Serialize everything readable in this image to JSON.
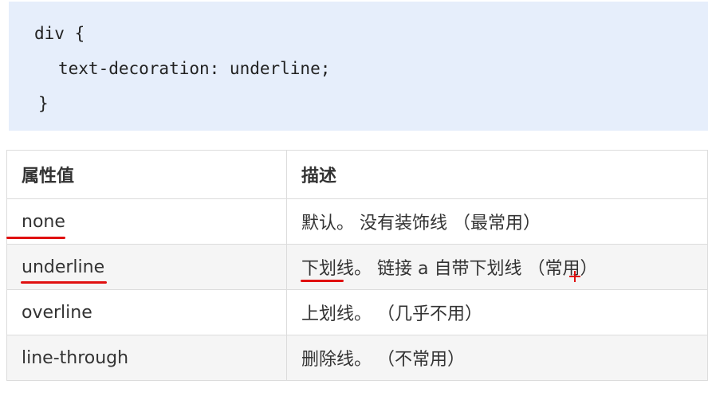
{
  "code": {
    "line1": "div {",
    "line2": "text-decoration: underline;",
    "line3": "}"
  },
  "table": {
    "headers": [
      "属性值",
      "描述"
    ],
    "rows": [
      {
        "value": "none",
        "description": "默认。 没有装饰线 （最常用）"
      },
      {
        "value": "underline",
        "description": "下划线。 链接 a 自带下划线 （常用）"
      },
      {
        "value": "overline",
        "description": "上划线。 （几乎不用）"
      },
      {
        "value": "line-through",
        "description": "删除线。 （不常用）"
      }
    ]
  },
  "annotations": {
    "color": "#e01010",
    "marks": [
      "underline-under-none",
      "underline-under-underline",
      "underline-under-下划线",
      "plus-cursor-mark"
    ]
  }
}
